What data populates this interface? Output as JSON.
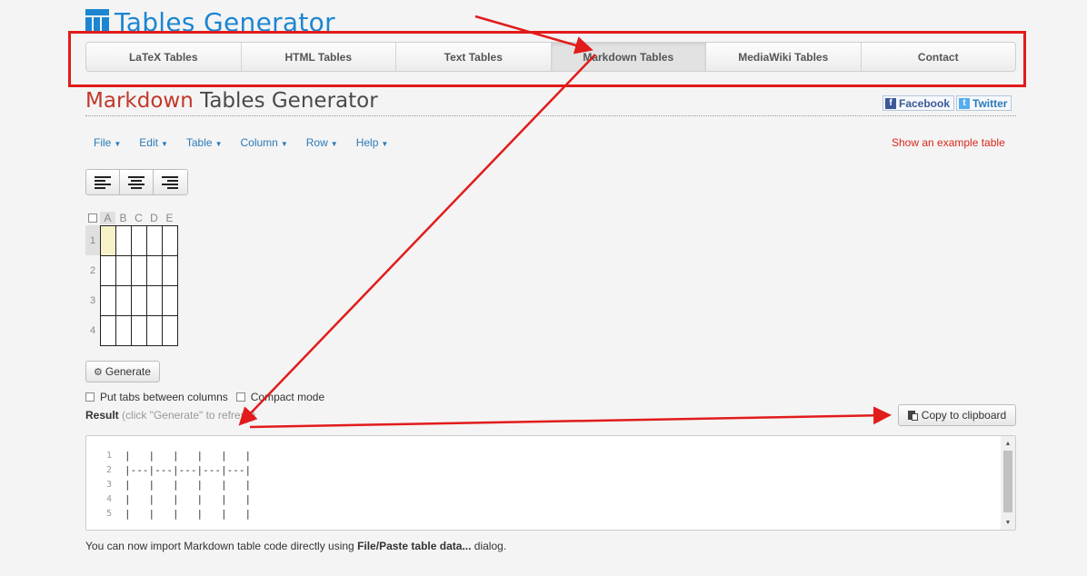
{
  "logo": {
    "text": "Tables Generator"
  },
  "nav": {
    "tabs": [
      {
        "label": "LaTeX Tables",
        "active": false
      },
      {
        "label": "HTML Tables",
        "active": false
      },
      {
        "label": "Text Tables",
        "active": false
      },
      {
        "label": "Markdown Tables",
        "active": true
      },
      {
        "label": "MediaWiki Tables",
        "active": false
      },
      {
        "label": "Contact",
        "active": false
      }
    ]
  },
  "title": {
    "accent": "Markdown",
    "rest": "Tables Generator"
  },
  "social": {
    "facebook": "Facebook",
    "twitter": "Twitter"
  },
  "menu": {
    "items": [
      "File",
      "Edit",
      "Table",
      "Column",
      "Row",
      "Help"
    ],
    "example_link": "Show an example table"
  },
  "grid": {
    "columns": [
      "A",
      "B",
      "C",
      "D",
      "E"
    ],
    "rows": [
      "1",
      "2",
      "3",
      "4"
    ]
  },
  "generate": {
    "label": "Generate"
  },
  "options": {
    "tabs_label": "Put tabs between columns",
    "compact_label": "Compact mode"
  },
  "result": {
    "label": "Result",
    "hint": "(click \"Generate\" to refresh)",
    "copy_label": "Copy to clipboard"
  },
  "code": {
    "lines": [
      {
        "n": "1",
        "text": "|   |   |   |   |   |"
      },
      {
        "n": "2",
        "text": "|---|---|---|---|---|"
      },
      {
        "n": "3",
        "text": "|   |   |   |   |   |"
      },
      {
        "n": "4",
        "text": "|   |   |   |   |   |"
      },
      {
        "n": "5",
        "text": "|   |   |   |   |   |"
      }
    ]
  },
  "footer": {
    "prefix": "You can now import Markdown table code directly using ",
    "bold": "File/Paste table data...",
    "suffix": " dialog."
  },
  "colors": {
    "accent": "#1c86d1",
    "annotation": "#e21b1b",
    "link": "#2a7ab8",
    "title_accent": "#c0392b"
  }
}
